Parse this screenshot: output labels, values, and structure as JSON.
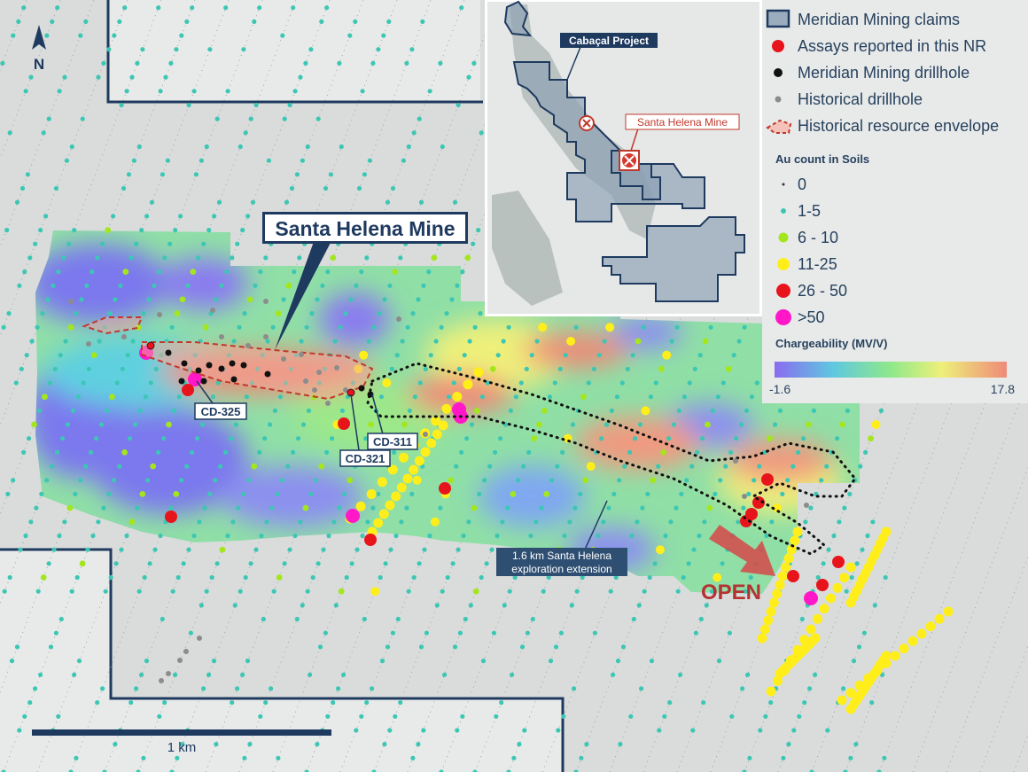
{
  "north_label": "N",
  "scale_label": "1 km",
  "main_label": "Santa Helena Mine",
  "holes": [
    "CD-325",
    "CD-311",
    "CD-321"
  ],
  "extension_label_line1": "1.6 km Santa Helena",
  "extension_label_line2": "exploration extension",
  "open_label": "OPEN",
  "inset": {
    "project_label": "Cabaçal Project",
    "mine_label": "Santa Helena Mine"
  },
  "legend": {
    "claims": "Meridian Mining claims",
    "assays": "Assays reported in this NR",
    "drillhole": "Meridian Mining drillhole",
    "historical_drillhole": "Historical drillhole",
    "resource": "Historical resource envelope",
    "au_title": "Au count in Soils",
    "au_classes": [
      "0",
      "1-5",
      "6 - 10",
      "11-25",
      "26 - 50",
      ">50"
    ],
    "charge_title": "Chargeability (MV/V)",
    "charge_min": "-1.6",
    "charge_max": "17.8"
  },
  "colors": {
    "claim_outline": "#1e3a5f",
    "background": "#d9dcdb",
    "assay_red": "#e8141c",
    "drillhole_black": "#111111",
    "historical_grey": "#8c8c8c",
    "au_1_5": "#3cc7b4",
    "au_6_10": "#a4e61e",
    "au_11_25": "#ffee1a",
    "au_26_50": "#e8141c",
    "au_gt50": "#ff17c8",
    "resource_outline": "#c0392b"
  }
}
